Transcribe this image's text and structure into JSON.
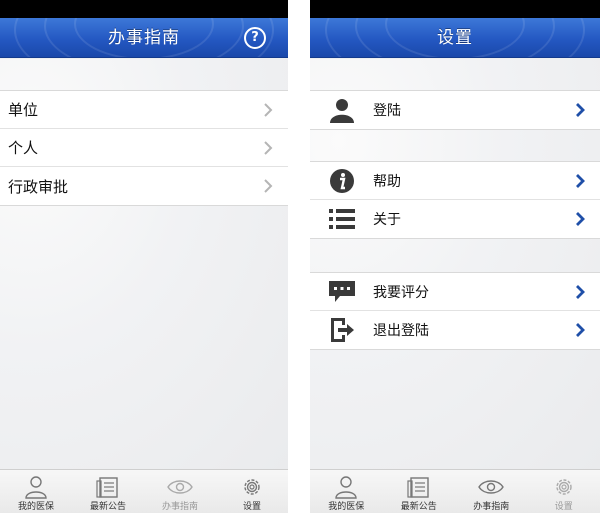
{
  "left_screen": {
    "nav_title": "办事指南",
    "help_glyph": "?",
    "menu_items": [
      {
        "label": "单位"
      },
      {
        "label": "个人"
      },
      {
        "label": "行政审批"
      }
    ],
    "tabs": [
      {
        "label": "我的医保",
        "icon": "person-icon"
      },
      {
        "label": "最新公告",
        "icon": "notice-icon"
      },
      {
        "label": "办事指南",
        "icon": "eye-icon",
        "active": true
      },
      {
        "label": "设置",
        "icon": "gear-icon"
      }
    ]
  },
  "right_screen": {
    "nav_title": "设置",
    "groups": [
      [
        {
          "label": "登陆",
          "icon": "user-silhouette-icon"
        }
      ],
      [
        {
          "label": "帮助",
          "icon": "info-icon"
        },
        {
          "label": "关于",
          "icon": "list-icon"
        }
      ],
      [
        {
          "label": "我要评分",
          "icon": "comment-icon"
        },
        {
          "label": "退出登陆",
          "icon": "logout-icon"
        }
      ]
    ],
    "tabs": [
      {
        "label": "我的医保",
        "icon": "person-icon"
      },
      {
        "label": "最新公告",
        "icon": "notice-icon"
      },
      {
        "label": "办事指南",
        "icon": "eye-icon"
      },
      {
        "label": "设置",
        "icon": "gear-icon",
        "active": true
      }
    ]
  },
  "colors": {
    "nav_blue": "#2458c2",
    "chevron_blue": "#1f4fa8",
    "chevron_gray": "#b5b5b5"
  }
}
